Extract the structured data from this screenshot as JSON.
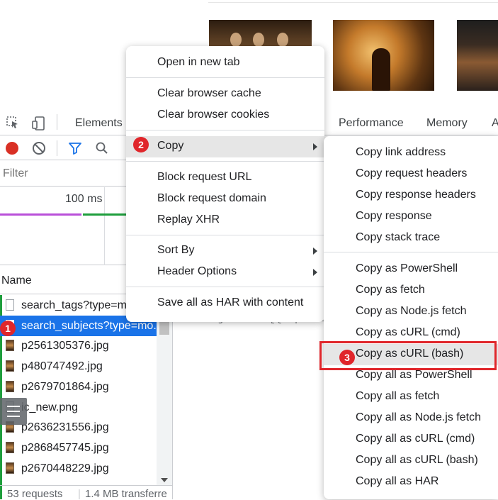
{
  "devtools": {
    "tabs": {
      "elements": "Elements",
      "performance": "Performance",
      "memory": "Memory",
      "application_partial": "A"
    },
    "filter_placeholder": "Filter",
    "timeline_label": "100 ms",
    "list_header": "Name",
    "rows": [
      "search_tags?type=m",
      "search_subjects?type=mo...",
      "p2561305376.jpg",
      "p480747492.jpg",
      "p2679701864.jpg",
      "ic_new.png",
      "p2636231556.jpg",
      "p2868457745.jpg",
      "p2670448229.jpg"
    ],
    "status": {
      "requests": "53 requests",
      "transferred": "1.4 MB transferre"
    },
    "preview_text": "\"subjects\": [{\"episode"
  },
  "context_menu": {
    "open_new_tab": "Open in new tab",
    "clear_cache": "Clear browser cache",
    "clear_cookies": "Clear browser cookies",
    "copy": "Copy",
    "block_url": "Block request URL",
    "block_domain": "Block request domain",
    "replay_xhr": "Replay XHR",
    "sort_by": "Sort By",
    "header_options": "Header Options",
    "save_har": "Save all as HAR with content"
  },
  "copy_submenu": {
    "link_address": "Copy link address",
    "request_headers": "Copy request headers",
    "response_headers": "Copy response headers",
    "response": "Copy response",
    "stack_trace": "Copy stack trace",
    "as_powershell": "Copy as PowerShell",
    "as_fetch": "Copy as fetch",
    "as_node_fetch": "Copy as Node.js fetch",
    "as_curl_cmd": "Copy as cURL (cmd)",
    "as_curl_bash": "Copy as cURL (bash)",
    "all_powershell": "Copy all as PowerShell",
    "all_fetch": "Copy all as fetch",
    "all_node_fetch": "Copy all as Node.js fetch",
    "all_curl_cmd": "Copy all as cURL (cmd)",
    "all_curl_bash": "Copy all as cURL (bash)",
    "all_har": "Copy all as HAR"
  },
  "annotations": {
    "step1": "1",
    "step2": "2",
    "step3": "3"
  },
  "colors": {
    "selection": "#1a73e8",
    "badge": "#e0262b",
    "record": "#d93025"
  },
  "icons": [
    "inspect-icon",
    "device-toolbar-icon",
    "record-icon",
    "clear-icon",
    "filter-icon",
    "search-icon",
    "submenu-arrow-icon",
    "file-icon",
    "image-file-icon"
  ]
}
